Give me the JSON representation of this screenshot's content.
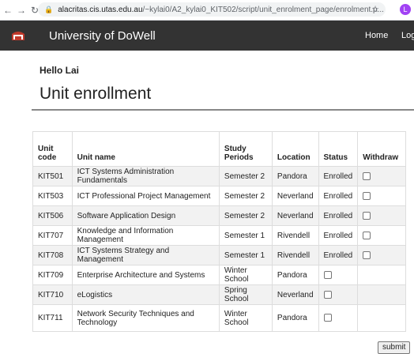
{
  "browser": {
    "url_host": "alacritas.cis.utas.edu.au",
    "url_path": "/~kylai0/A2_kylai0_KIT502/script/unit_enrolment_page/enrolment.p...",
    "profile_initial": "L"
  },
  "header": {
    "brand": "University of DoWell",
    "nav_home": "Home",
    "nav_login": "Log"
  },
  "greeting": "Hello Lai",
  "page_title": "Unit enrollment",
  "table": {
    "headers": {
      "unit_code": "Unit code",
      "unit_name": "Unit name",
      "study_periods": "Study Periods",
      "location": "Location",
      "status": "Status",
      "withdraw": "Withdraw"
    },
    "rows": [
      {
        "code": "KIT501",
        "name": "ICT Systems Administration Fundamentals",
        "period": "Semester 2",
        "location": "Pandora",
        "status": "Enrolled"
      },
      {
        "code": "KIT503",
        "name": "ICT Professional Project Management",
        "period": "Semester 2",
        "location": "Neverland",
        "status": "Enrolled"
      },
      {
        "code": "KIT506",
        "name": "Software Application Design",
        "period": "Semester 2",
        "location": "Neverland",
        "status": "Enrolled"
      },
      {
        "code": "KIT707",
        "name": "Knowledge and Information Management",
        "period": "Semester 1",
        "location": "Rivendell",
        "status": "Enrolled"
      },
      {
        "code": "KIT708",
        "name": "ICT Systems Strategy and Management",
        "period": "Semester 1",
        "location": "Rivendell",
        "status": "Enrolled"
      },
      {
        "code": "KIT709",
        "name": "Enterprise Architecture and Systems",
        "period": "Winter School",
        "location": "Pandora",
        "status": ""
      },
      {
        "code": "KIT710",
        "name": "eLogistics",
        "period": "Spring School",
        "location": "Neverland",
        "status": ""
      },
      {
        "code": "KIT711",
        "name": "Network Security Techniques and Technology",
        "period": "Winter School",
        "location": "Pandora",
        "status": ""
      }
    ]
  },
  "submit_label": "submit"
}
